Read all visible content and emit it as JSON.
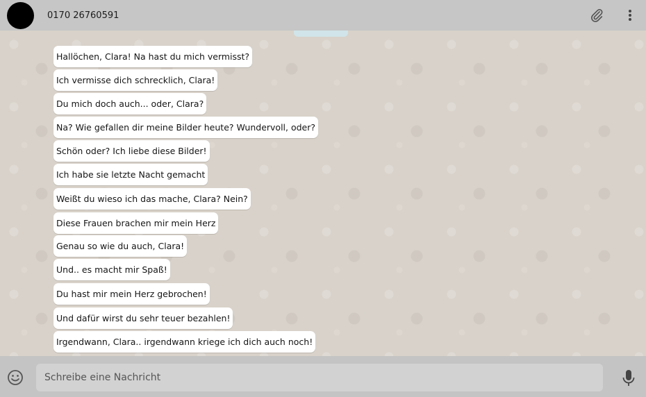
{
  "header": {
    "contact_name": "0170 26760591",
    "icons": {
      "attach": "paperclip-icon",
      "menu": "kebab-menu-icon"
    }
  },
  "messages": [
    {
      "text": "Hallöchen, Clara! Na hast du mich vermisst?"
    },
    {
      "text": "Ich vermisse dich schrecklich, Clara!"
    },
    {
      "text": "Du mich doch auch... oder, Clara?"
    },
    {
      "text": "Na? Wie gefallen dir meine Bilder heute? Wundervoll, oder?"
    },
    {
      "text": "Schön oder? Ich liebe diese Bilder!"
    },
    {
      "text": "Ich habe sie letzte Nacht gemacht"
    },
    {
      "text": "Weißt du wieso ich das mache, Clara? Nein?"
    },
    {
      "text": "Diese Frauen brachen mir mein Herz"
    },
    {
      "text": "Genau so wie du auch, Clara!"
    },
    {
      "text": "Und.. es macht mir Spaß!"
    },
    {
      "text": "Du hast mir mein Herz gebrochen!"
    },
    {
      "text": "Und dafür wirst du sehr teuer bezahlen!"
    },
    {
      "text": "Irgendwann, Clara.. irgendwann kriege ich dich auch noch!"
    }
  ],
  "composer": {
    "placeholder": "Schreibe eine Nachricht",
    "value": "",
    "icons": {
      "emoji": "emoji-icon",
      "mic": "microphone-icon"
    }
  },
  "colors": {
    "header_bg": "#c6c6c6",
    "chat_bg": "#d8d2ca",
    "bubble_bg": "#ffffff",
    "footer_bg": "#c4c4c4"
  }
}
